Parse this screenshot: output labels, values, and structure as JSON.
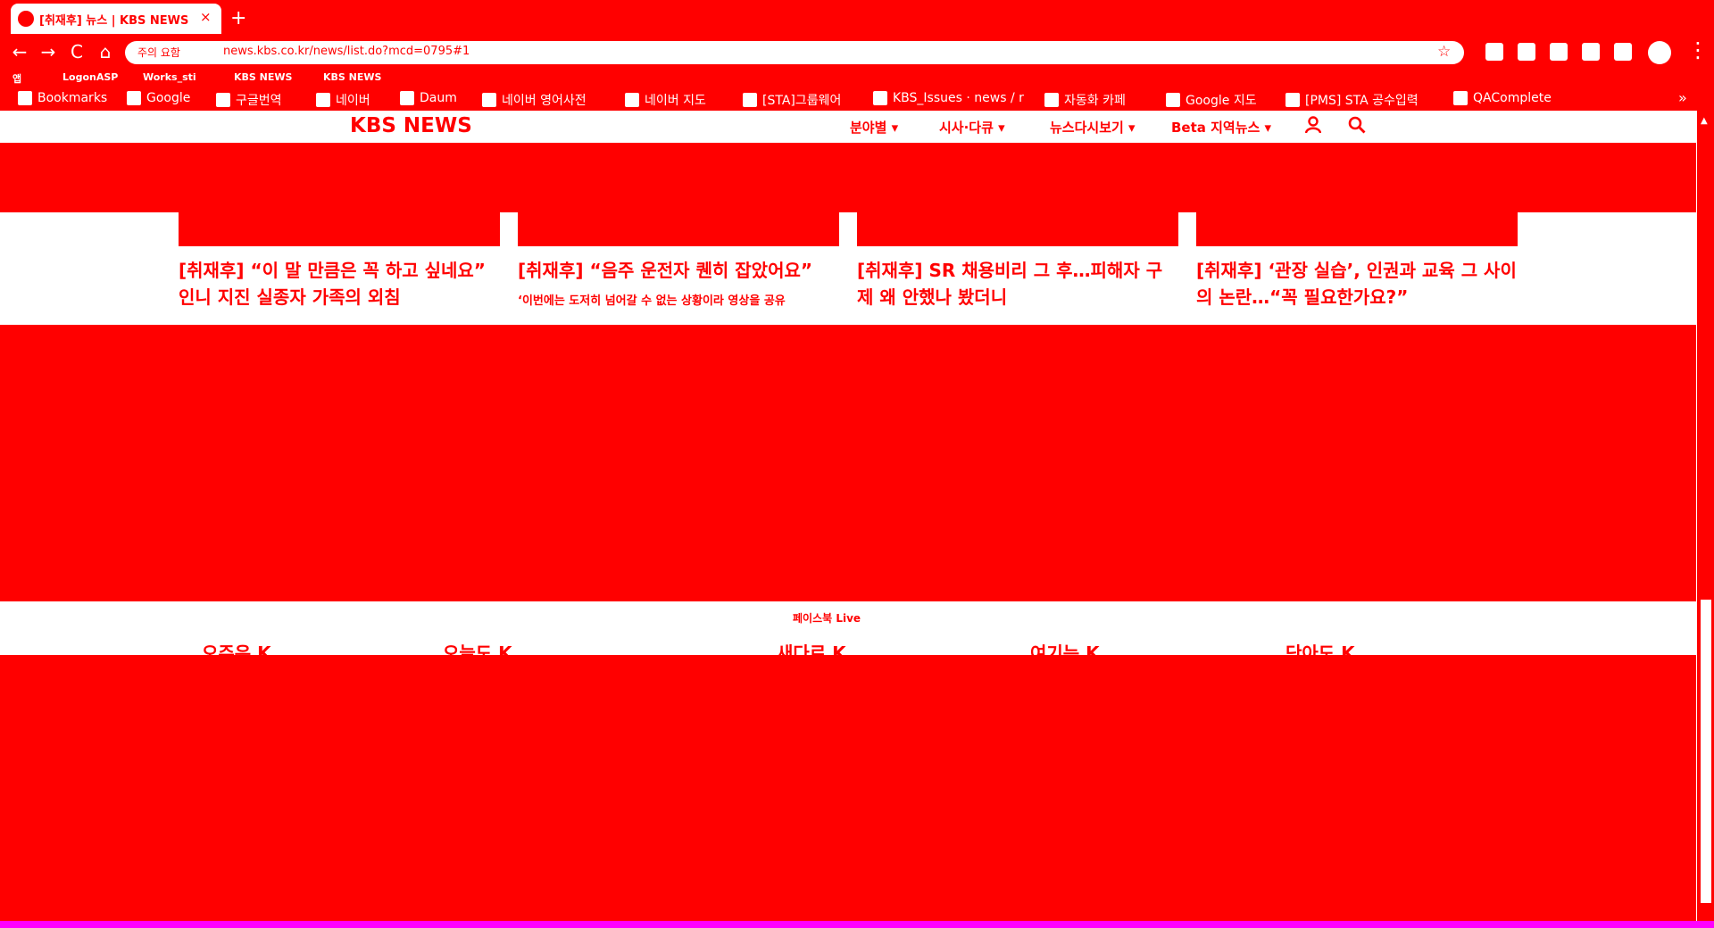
{
  "browser": {
    "tab_title": "[취재후] 뉴스 | KBS NEWS",
    "tab_close": "×",
    "new_tab": "+",
    "nav": {
      "back": "←",
      "forward": "→",
      "reload": "C",
      "home": "⌂"
    },
    "security_label": "주의 요함",
    "url": "news.kbs.co.kr/news/list.do?mcd=0795#1",
    "star": "☆",
    "menu": "⋮"
  },
  "apps_bar": {
    "items": [
      "앱",
      "LogonASP",
      "Works_sti",
      "KBS NEWS",
      "KBS NEWS"
    ]
  },
  "bookmarks": {
    "items": [
      "Bookmarks",
      "Google",
      "구글번역",
      "네이버",
      "Daum",
      "네이버 영어사전",
      "네이버 지도",
      "[STA]그룹웨어",
      "KBS_Issues · news / r",
      "자동화 카페",
      "Google 지도",
      "[PMS] STA 공수입력",
      "QAComplete"
    ],
    "more": "»"
  },
  "kbs_header": {
    "logo": "KBS NEWS",
    "menus": [
      "분야별 ▾",
      "시사·다큐 ▾",
      "뉴스다시보기 ▾",
      "Beta 지역뉴스 ▾"
    ]
  },
  "articles": [
    {
      "title": "[취재후] “이 말 만큼은 꼭 하고 싶네요” 인니 지진 실종자 가족의 외침",
      "sub": ""
    },
    {
      "title": "[취재후] “음주 운전자 퀜히 잡았어요”",
      "sub": "‘이번에는 도저히 넘어갈 수 없는 상황이라 영상을 공유"
    },
    {
      "title": "[취재후] SR 채용비리 그 후…피해자 구제 왜 안했나 봤더니",
      "sub": ""
    },
    {
      "title": "[취재후] ‘관장 실습’, 인권과 교육 그 사이의 논란…“꼭 필요한가요?”",
      "sub": ""
    }
  ],
  "live": {
    "label": "페이스북 Live",
    "items": [
      "오주은 K",
      "오늘도 K",
      "새다르 K",
      "여기는 K",
      "단아도 K"
    ]
  },
  "scrollbar": {
    "up": "▲"
  },
  "colors": {
    "primary": "#ff0000",
    "panel": "#ffffff",
    "bottom_line": "#ff00ff"
  }
}
